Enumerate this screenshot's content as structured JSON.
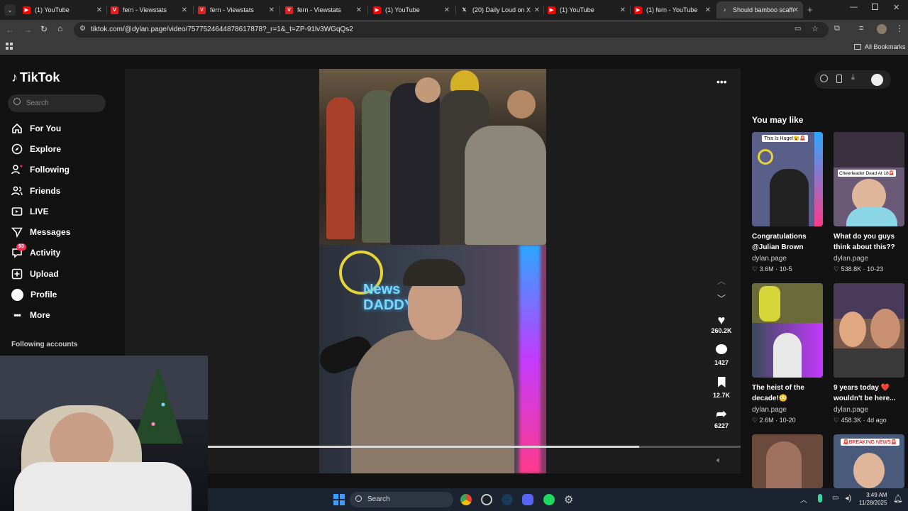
{
  "tabs": [
    {
      "title": "(1) YouTube",
      "icon": "youtube-icon",
      "color": "#ff0000"
    },
    {
      "title": "fern - Viewstats",
      "icon": "viewstats-icon",
      "color": "#e02020"
    },
    {
      "title": "fern - Viewstats",
      "icon": "viewstats-icon",
      "color": "#e02020"
    },
    {
      "title": "fern - Viewstats",
      "icon": "viewstats-icon",
      "color": "#e02020"
    },
    {
      "title": "(1) YouTube",
      "icon": "youtube-icon",
      "color": "#ff0000"
    },
    {
      "title": "(20) Daily Loud on X",
      "icon": "x-icon",
      "color": "#ffffff"
    },
    {
      "title": "(1) YouTube",
      "icon": "youtube-icon",
      "color": "#ff0000"
    },
    {
      "title": "(1) fern - YouTube",
      "icon": "youtube-icon",
      "color": "#ff0000"
    },
    {
      "title": "Should bamboo scaffo",
      "icon": "tiktok-icon",
      "color": "#ffffff"
    }
  ],
  "browser": {
    "url": "tiktok.com/@dylan.page/video/7577524644878617878?_r=1&_t=ZP-91lv3WGqQs2",
    "all_bookmarks": "All Bookmarks"
  },
  "sidebar": {
    "logo": "TikTok",
    "search_placeholder": "Search",
    "items": [
      {
        "label": "For You",
        "icon": "home-icon"
      },
      {
        "label": "Explore",
        "icon": "compass-icon"
      },
      {
        "label": "Following",
        "icon": "following-icon"
      },
      {
        "label": "Friends",
        "icon": "friends-icon"
      },
      {
        "label": "LIVE",
        "icon": "live-icon"
      },
      {
        "label": "Messages",
        "icon": "messages-icon"
      },
      {
        "label": "Activity",
        "icon": "activity-icon",
        "badge": "93"
      },
      {
        "label": "Upload",
        "icon": "upload-icon"
      },
      {
        "label": "Profile",
        "icon": "profile-icon"
      },
      {
        "label": "More",
        "icon": "more-icon"
      }
    ],
    "following_accounts": "Following accounts"
  },
  "video": {
    "top_caption": "",
    "sign_text": "News DADDY",
    "likes": "260.2K",
    "comments": "1427",
    "saves": "12.7K",
    "shares": "6227",
    "progress": 0.81
  },
  "recommended": {
    "heading": "You may like",
    "cards": [
      {
        "title": "Congratulations @Julian Brown",
        "author": "dylan.page",
        "views": "3.6M",
        "date": "10-5",
        "overlay": "This Is Huge!😮🚨",
        "thumb_color": "#5a5f8a"
      },
      {
        "title": "What do you guys think about this??",
        "author": "dylan.page",
        "views": "538.8K",
        "date": "10-23",
        "overlay": "Cheerleader Dead At 18🚨",
        "thumb_color": "#6a5a78"
      },
      {
        "title": "The heist of the decade!😳",
        "author": "dylan.page",
        "views": "2.6M",
        "date": "10-20",
        "overlay": "",
        "thumb_color": "#4a5a4a"
      },
      {
        "title": "9 years today ❤️ wouldn't be here...",
        "author": "dylan.page",
        "views": "458.3K",
        "date": "4d ago",
        "overlay": "",
        "thumb_color": "#7a5a4a"
      },
      {
        "title": "",
        "author": "",
        "views": "",
        "date": "",
        "overlay": "",
        "thumb_color": "#6a4a3a"
      },
      {
        "title": "",
        "author": "",
        "views": "",
        "date": "",
        "overlay": "🚨BREAKING NEWS🚨",
        "thumb_color": "#4a5a7a"
      }
    ]
  },
  "taskbar": {
    "search": "Search",
    "time": "3:49 AM",
    "date": "11/28/2025"
  }
}
